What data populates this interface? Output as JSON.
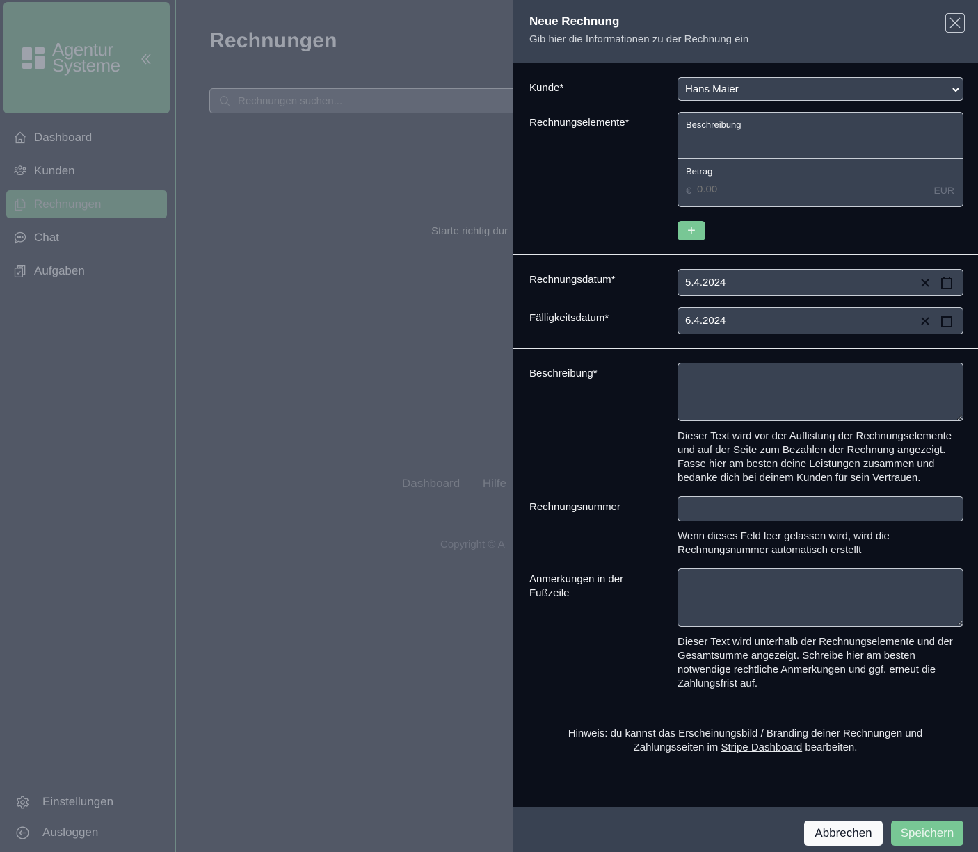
{
  "sidebar": {
    "logo": {
      "line1": "Agentur",
      "line2": "Systeme",
      "icon": "logo-grid-icon"
    },
    "collapse_icon": "chevrons-left-icon",
    "items": [
      {
        "label": "Dashboard",
        "icon": "home-icon",
        "active": false
      },
      {
        "label": "Kunden",
        "icon": "users-icon",
        "active": false
      },
      {
        "label": "Rechnungen",
        "icon": "documents-icon",
        "active": true
      },
      {
        "label": "Chat",
        "icon": "chat-bubble-icon",
        "active": false
      },
      {
        "label": "Aufgaben",
        "icon": "clipboard-check-icon",
        "active": false
      }
    ],
    "bottom_items": [
      {
        "label": "Einstellungen",
        "icon": "gear-icon"
      },
      {
        "label": "Ausloggen",
        "icon": "logout-arrow-icon"
      }
    ]
  },
  "main": {
    "title": "Rechnungen",
    "search": {
      "placeholder": "Rechnungen suchen...",
      "value": ""
    },
    "empty_text": "Starte richtig dur",
    "footer_links": [
      "Dashboard",
      "Hilfe"
    ],
    "copyright": "Copyright © A"
  },
  "drawer": {
    "title": "Neue Rechnung",
    "subtitle": "Gib hier die Informationen zu der Rechnung ein",
    "close_icon": "close-x-icon",
    "customer": {
      "label": "Kunde*",
      "selected": "Hans Maier"
    },
    "items": {
      "label": "Rechnungselemente*",
      "description_label": "Beschreibung",
      "amount_label": "Betrag",
      "currency_symbol": "€",
      "amount_value": "0.00",
      "currency_code": "EUR",
      "add_label": "+"
    },
    "invoice_date": {
      "label": "Rechnungsdatum*",
      "value": "5.4.2024"
    },
    "due_date": {
      "label": "Fälligkeitsdatum*",
      "value": "6.4.2024"
    },
    "description": {
      "label": "Beschreibung*",
      "value": "",
      "help": "Dieser Text wird vor der Auflistung der Rechnungselemente und auf der Seite zum Bezahlen der Rechnung angezeigt. Fasse hier am besten deine Leistungen zusammen und bedanke dich bei deinem Kunden für sein Vertrauen."
    },
    "invoice_number": {
      "label": "Rechnungsnummer",
      "value": "",
      "help": "Wenn dieses Feld leer gelassen wird, wird die Rechnungsnummer automatisch erstellt"
    },
    "footer_notes": {
      "label": "Anmerkungen in der Fußzeile",
      "value": "",
      "help": "Dieser Text wird unterhalb der Rechnungselemente und der Gesamtsumme angezeigt. Schreibe hier am besten notwendige rechtliche Anmerkungen und ggf. erneut die Zahlungsfrist auf."
    },
    "hint": {
      "prefix": "Hinweis: du kannst das Erscheinungsbild / Branding deiner Rechnungen und Zahlungsseiten im ",
      "link": "Stripe Dashboard",
      "suffix": " bearbeiten."
    },
    "cancel_label": "Abbrechen",
    "save_label": "Speichern"
  },
  "colors": {
    "accent_green": "#78c795",
    "sidebar_active": "#6d8781",
    "drawer_bg": "#0b0f1a",
    "drawer_header_bg": "#394252",
    "overlay_bg": "#525866"
  }
}
